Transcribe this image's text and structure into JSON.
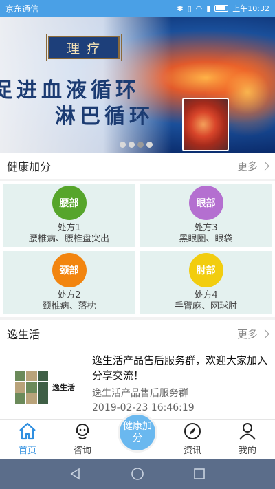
{
  "status_bar": {
    "carrier": "京东通信",
    "time": "上午10:32"
  },
  "banner": {
    "tag": "理疗",
    "line1": "促进血液循环",
    "line2": "淋巴循环",
    "dots": 4,
    "active_dot": 3
  },
  "section_health": {
    "title": "健康加分",
    "more": "更多"
  },
  "prescriptions": [
    {
      "part": "腰部",
      "name": "处方1",
      "desc": "腰椎病、腰椎盘突出",
      "color": "#56a52b"
    },
    {
      "part": "眼部",
      "name": "处方3",
      "desc": "黑眼圈、眼袋",
      "color": "#b46fd0"
    },
    {
      "part": "颈部",
      "name": "处方2",
      "desc": "颈椎病、落枕",
      "color": "#f2850f"
    },
    {
      "part": "肘部",
      "name": "处方4",
      "desc": "手臂麻、网球肘",
      "color": "#f2cd0f"
    }
  ],
  "section_life": {
    "title": "逸生活",
    "more": "更多"
  },
  "news": {
    "thumb_label": "逸生活",
    "headline": "逸生活产品售后服务群，欢迎大家加入分享交流！",
    "source": "逸生活产品售后服务群",
    "time": "2019-02-23 16:46:19"
  },
  "tabs": {
    "home": "首页",
    "consult": "咨询",
    "center": "健康加分",
    "news": "资讯",
    "mine": "我的"
  },
  "colors": {
    "accent": "#2f8fe0",
    "center_bubble": "#6ab8ef"
  }
}
